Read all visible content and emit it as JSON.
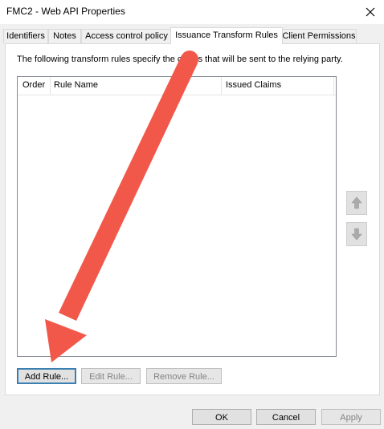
{
  "window": {
    "title": "FMC2 - Web API Properties"
  },
  "tabs": [
    {
      "label": "Identifiers"
    },
    {
      "label": "Notes"
    },
    {
      "label": "Access control policy"
    },
    {
      "label": "Issuance Transform Rules"
    },
    {
      "label": "Client Permissions"
    }
  ],
  "active_tab": "Issuance Transform Rules",
  "panel": {
    "description": "The following transform rules specify the claims that will be sent to the relying party.",
    "columns": [
      "Order",
      "Rule Name",
      "Issued Claims"
    ],
    "rows": []
  },
  "rule_buttons": {
    "add": "Add Rule...",
    "edit": "Edit Rule...",
    "remove": "Remove Rule..."
  },
  "footer": {
    "ok": "OK",
    "cancel": "Cancel",
    "apply": "Apply"
  },
  "icons": {
    "move_up": "arrow-up-icon",
    "move_down": "arrow-down-icon",
    "close": "close-icon"
  },
  "colors": {
    "annotation_arrow": "#f2584a",
    "default_button_border": "#3c7fb1"
  }
}
